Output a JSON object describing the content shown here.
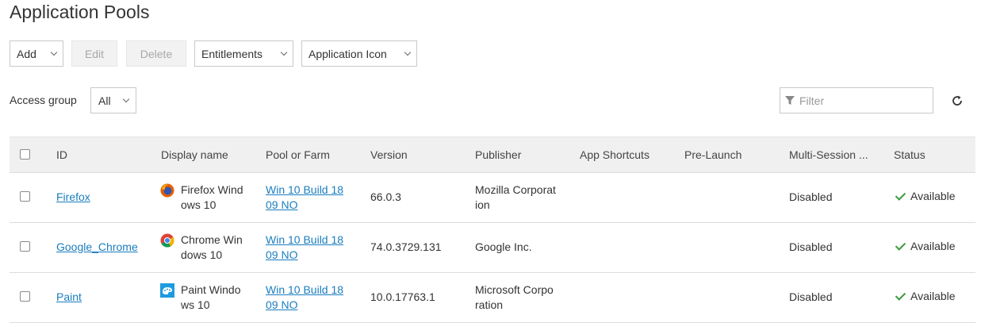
{
  "page": {
    "title": "Application Pools"
  },
  "toolbar": {
    "add": "Add",
    "edit": "Edit",
    "delete": "Delete",
    "entitlements": "Entitlements",
    "application_icon": "Application Icon"
  },
  "access_group": {
    "label": "Access group",
    "value": "All"
  },
  "filter": {
    "placeholder": "Filter",
    "value": ""
  },
  "table": {
    "headers": {
      "id": "ID",
      "display_name": "Display name",
      "pool_or_farm": "Pool or Farm",
      "version": "Version",
      "publisher": "Publisher",
      "app_shortcuts": "App Shortcuts",
      "pre_launch": "Pre-Launch",
      "multi_session": "Multi-Session ...",
      "status": "Status"
    },
    "rows": [
      {
        "id": "Firefox",
        "icon": "firefox-icon",
        "display_name_1": "Firefox Wind",
        "display_name_2": "ows 10",
        "pool_1": "Win 10 Build 18",
        "pool_2": "09 NO",
        "version": "66.0.3",
        "publisher_1": "Mozilla Corporat",
        "publisher_2": "ion",
        "app_shortcuts": "",
        "pre_launch": "",
        "multi_session": "Disabled",
        "status": "Available"
      },
      {
        "id": "Google_Chrome",
        "icon": "chrome-icon",
        "display_name_1": "Chrome Win",
        "display_name_2": "dows 10",
        "pool_1": "Win 10 Build 18",
        "pool_2": "09 NO",
        "version": "74.0.3729.131",
        "publisher_1": "Google Inc.",
        "publisher_2": "",
        "app_shortcuts": "",
        "pre_launch": "",
        "multi_session": "Disabled",
        "status": "Available"
      },
      {
        "id": "Paint",
        "icon": "paint-icon",
        "display_name_1": "Paint Windo",
        "display_name_2": "ws 10",
        "pool_1": "Win 10 Build 18",
        "pool_2": "09 NO",
        "version": "10.0.17763.1",
        "publisher_1": "Microsoft Corpo",
        "publisher_2": "ration",
        "app_shortcuts": "",
        "pre_launch": "",
        "multi_session": "Disabled",
        "status": "Available"
      }
    ]
  },
  "colors": {
    "link": "#1a7dbf",
    "header_bg": "#f0f0f0",
    "status_ok": "#3a9b3a"
  }
}
